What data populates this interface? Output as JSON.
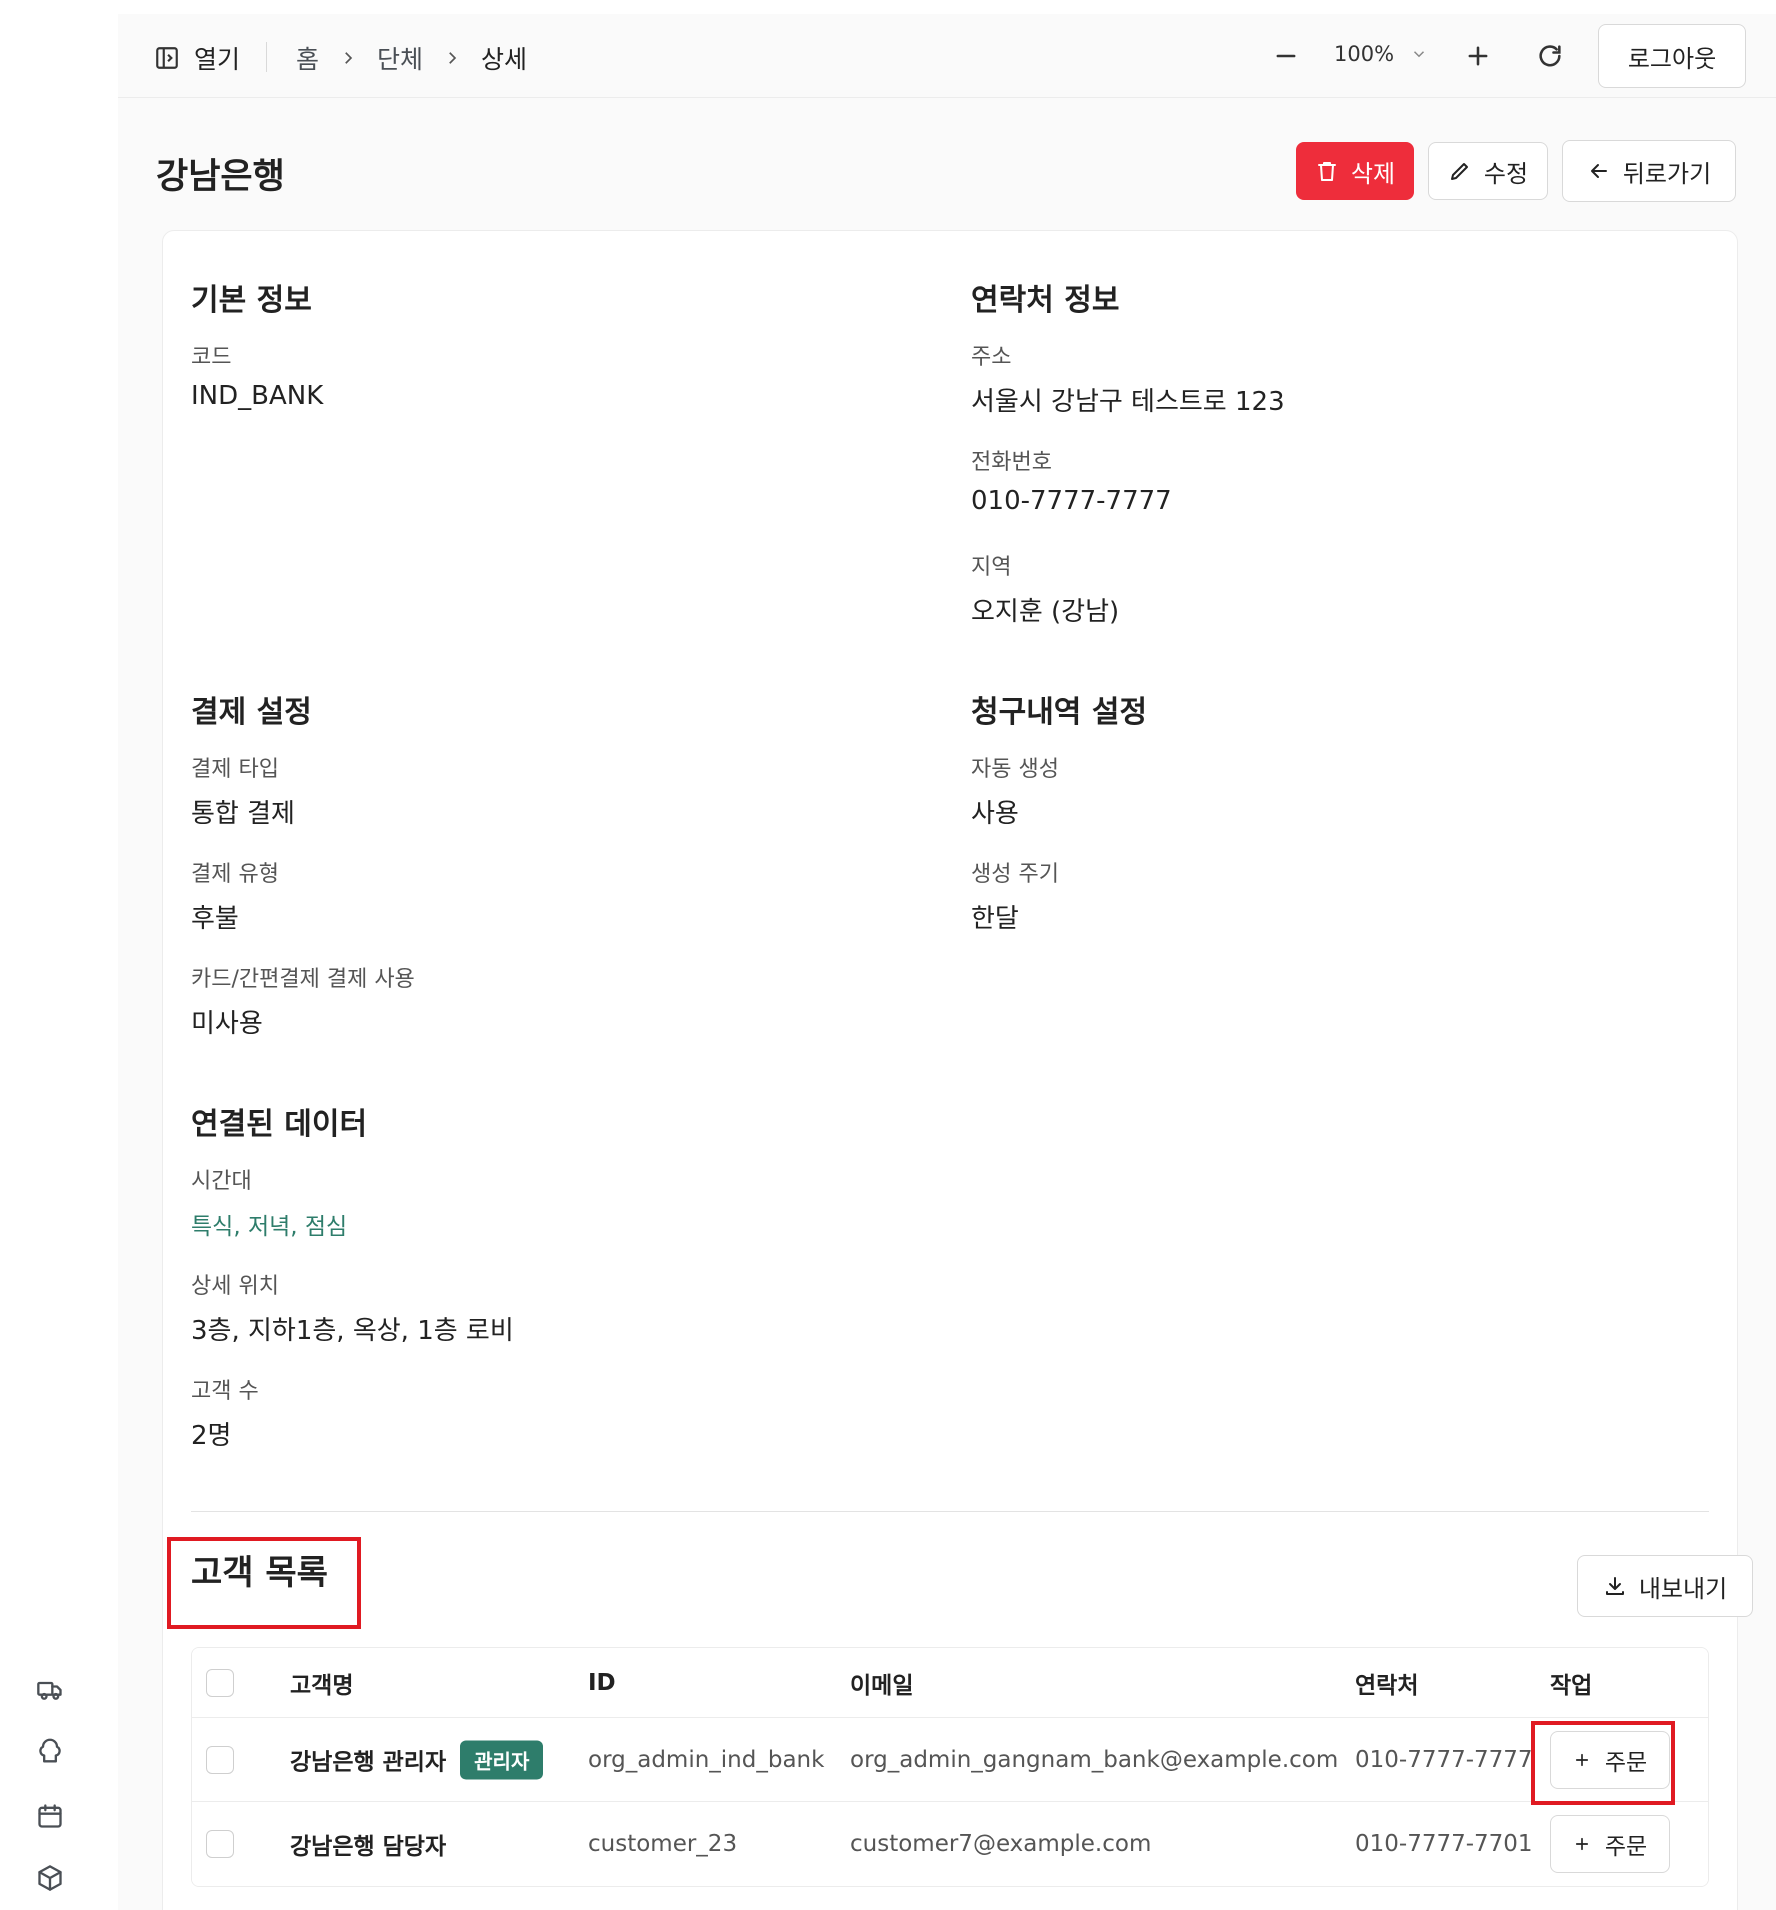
{
  "topbar": {
    "open_label": "열기",
    "breadcrumbs": [
      "홈",
      "단체",
      "상세"
    ],
    "zoom": "100%",
    "logout_label": "로그아웃"
  },
  "page": {
    "title": "강남은행",
    "delete_label": "삭제",
    "edit_label": "수정",
    "back_label": "뒤로가기"
  },
  "basic_info": {
    "title": "기본 정보",
    "code_label": "코드",
    "code_value": "IND_BANK"
  },
  "contact_info": {
    "title": "연락처 정보",
    "address_label": "주소",
    "address_value": "서울시 강남구 테스트로 123",
    "phone_label": "전화번호",
    "phone_value": "010-7777-7777",
    "region_label": "지역",
    "region_value": "오지훈 (강남)"
  },
  "payment": {
    "title": "결제 설정",
    "type_label": "결제 타입",
    "type_value": "통합 결제",
    "kind_label": "결제 유형",
    "kind_value": "후불",
    "card_label": "카드/간편결제 결제 사용",
    "card_value": "미사용"
  },
  "billing": {
    "title": "청구내역 설정",
    "auto_label": "자동 생성",
    "auto_value": "사용",
    "cycle_label": "생성 주기",
    "cycle_value": "한달"
  },
  "linked": {
    "title": "연결된 데이터",
    "time_label": "시간대",
    "time_value": "특식, 저녁, 점심",
    "location_label": "상세 위치",
    "location_value": "3층, 지하1층, 옥상, 1층 로비",
    "count_label": "고객 수",
    "count_value": "2명"
  },
  "customers": {
    "title": "고객 목록",
    "export_label": "내보내기",
    "columns": [
      "고객명",
      "ID",
      "이메일",
      "연락처",
      "작업"
    ],
    "rows": [
      {
        "name": "강남은행 관리자",
        "badge": "관리자",
        "id": "org_admin_ind_bank",
        "email": "org_admin_gangnam_bank@example.com",
        "phone": "010-7777-7777",
        "action": "주문"
      },
      {
        "name": "강남은행 담당자",
        "badge": "",
        "id": "customer_23",
        "email": "customer7@example.com",
        "phone": "010-7777-7701",
        "action": "주문"
      }
    ]
  },
  "colors": {
    "danger": "#ee2d3b",
    "accent": "#2e7d6b",
    "highlight": "#e01a22"
  },
  "icons": {
    "rail": [
      "truck-icon",
      "chef-hat-icon",
      "calendar-icon",
      "package-icon"
    ]
  }
}
